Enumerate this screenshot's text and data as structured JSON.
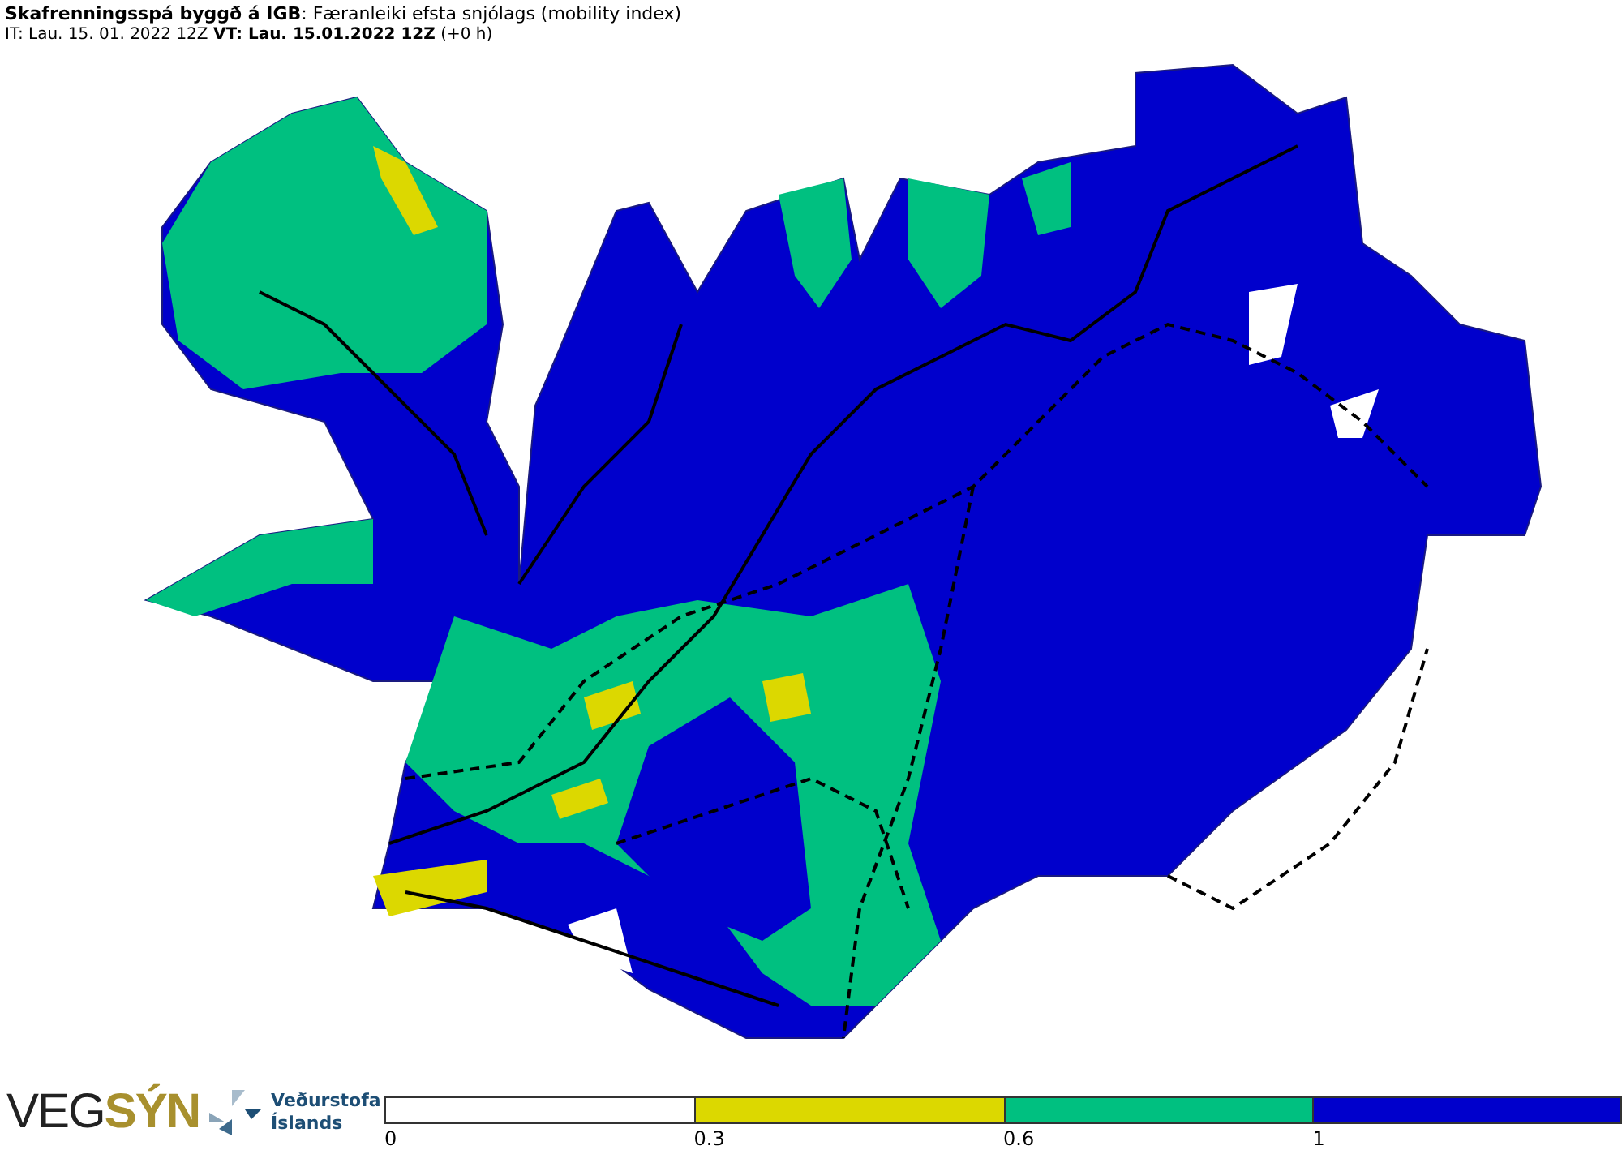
{
  "header": {
    "title": "**Skafrenningsspá byggð á IGB**: Færanleiki efsta snjólags (mobility index)",
    "subtitle": "IT: Lau. 15. 01. 2022 12Z **VT: Lau. 15.01.2022 12Z** (+0 h)"
  },
  "logos": {
    "vegsyn": {
      "part_1": "VEG",
      "part_2": "SÝN"
    },
    "vedurstofa": {
      "line_1": "Veðurstofa",
      "line_2": "Íslands"
    }
  },
  "legend": {
    "segments": [
      {
        "label": "0",
        "color": "#ffffff"
      },
      {
        "label": "0.3",
        "color": "#dcd800"
      },
      {
        "label": "0.6",
        "color": "#00c080"
      },
      {
        "label": "1",
        "color": "#0000cc"
      }
    ]
  }
}
